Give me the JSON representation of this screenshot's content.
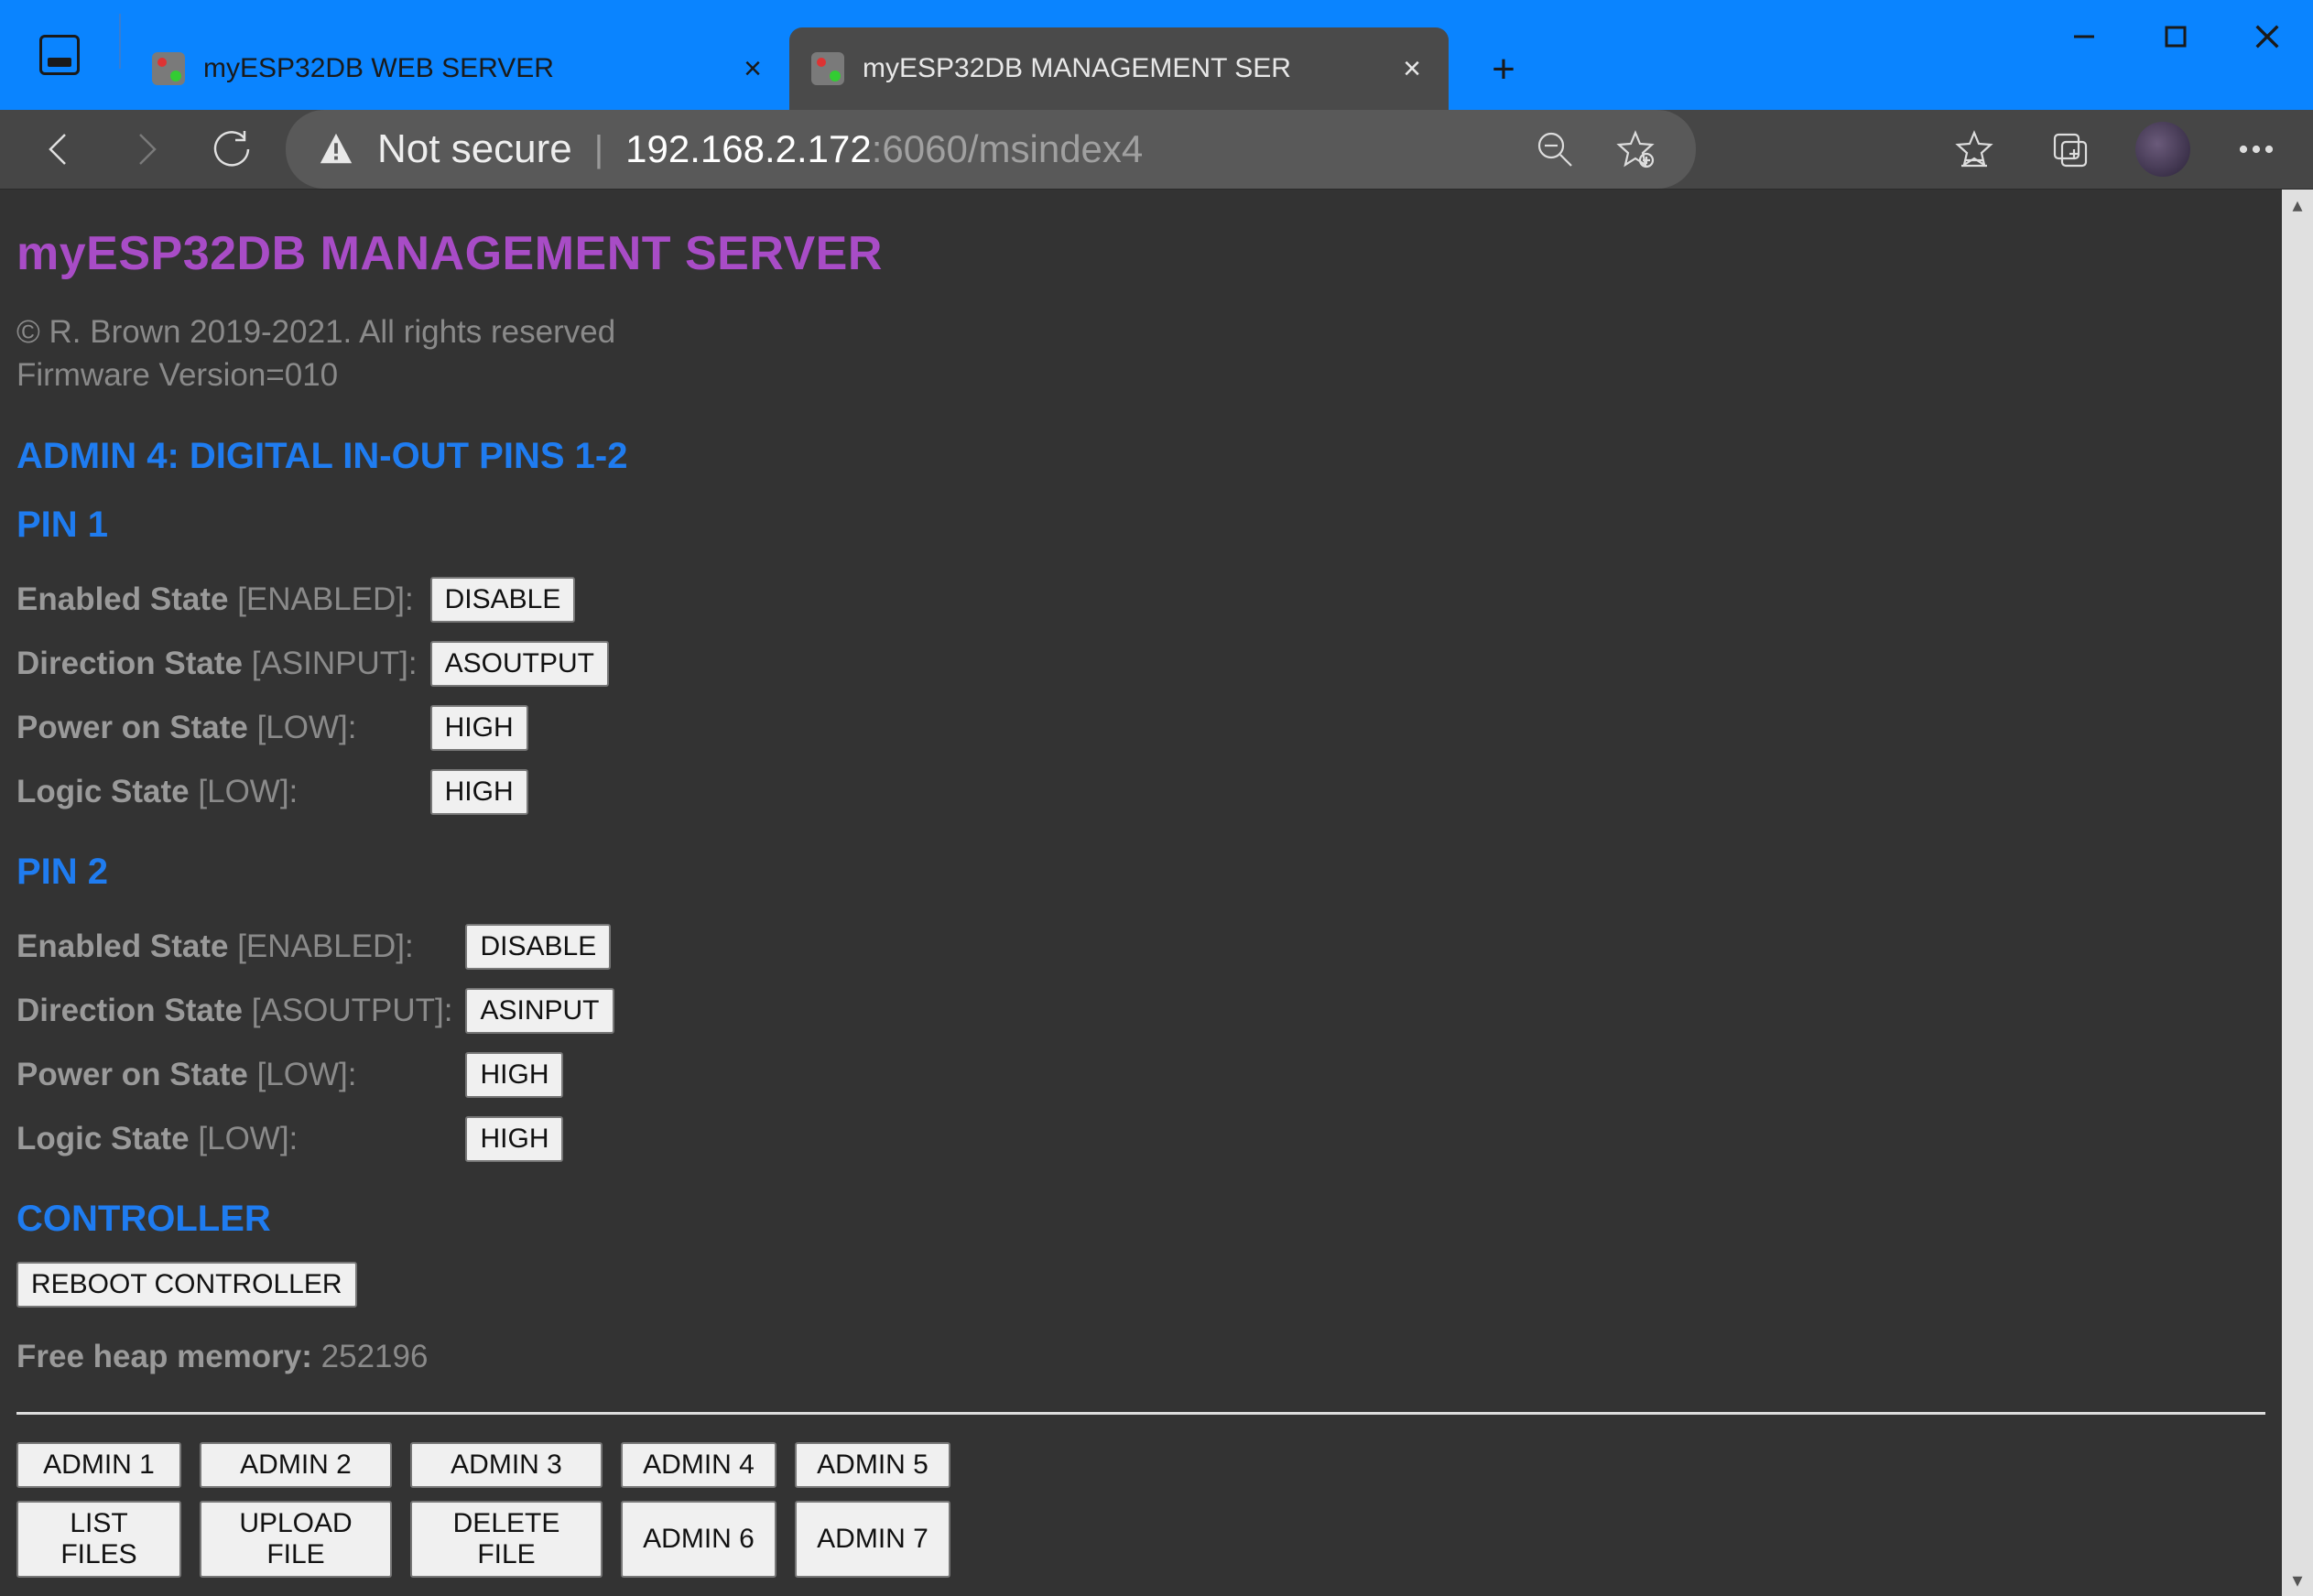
{
  "browser": {
    "tabs": [
      {
        "label": "myESP32DB WEB SERVER",
        "active": false
      },
      {
        "label": "myESP32DB MANAGEMENT SER",
        "active": true
      }
    ],
    "address": {
      "security_label": "Not secure",
      "host": "192.168.2.172",
      "rest": ":6060/msindex4"
    }
  },
  "page": {
    "title": "myESP32DB MANAGEMENT SERVER",
    "copyright": "© R. Brown 2019-2021. All rights reserved",
    "firmware": "Firmware Version=010",
    "section": "ADMIN 4: DIGITAL IN-OUT PINS 1-2",
    "pin1": {
      "heading": "PIN 1",
      "rows": [
        {
          "label": "Enabled State",
          "value": "[ENABLED]:",
          "button": "DISABLE"
        },
        {
          "label": "Direction State",
          "value": "[ASINPUT]:",
          "button": "ASOUTPUT"
        },
        {
          "label": "Power on State",
          "value": "[LOW]:",
          "button": "HIGH"
        },
        {
          "label": "Logic State",
          "value": "[LOW]:",
          "button": "HIGH"
        }
      ]
    },
    "pin2": {
      "heading": "PIN 2",
      "rows": [
        {
          "label": "Enabled State",
          "value": "[ENABLED]:",
          "button": "DISABLE"
        },
        {
          "label": "Direction State",
          "value": "[ASOUTPUT]:",
          "button": "ASINPUT"
        },
        {
          "label": "Power on State",
          "value": "[LOW]:",
          "button": "HIGH"
        },
        {
          "label": "Logic State",
          "value": "[LOW]:",
          "button": "HIGH"
        }
      ]
    },
    "controller_heading": "CONTROLLER",
    "reboot_label": "REBOOT CONTROLLER",
    "heap_label": "Free heap memory:",
    "heap_value": "252196",
    "nav": {
      "row1": [
        "ADMIN 1",
        "ADMIN 2",
        "ADMIN 3",
        "ADMIN 4",
        "ADMIN 5"
      ],
      "row2": [
        "LIST FILES",
        "UPLOAD FILE",
        "DELETE FILE",
        "ADMIN 6",
        "ADMIN 7"
      ]
    }
  }
}
